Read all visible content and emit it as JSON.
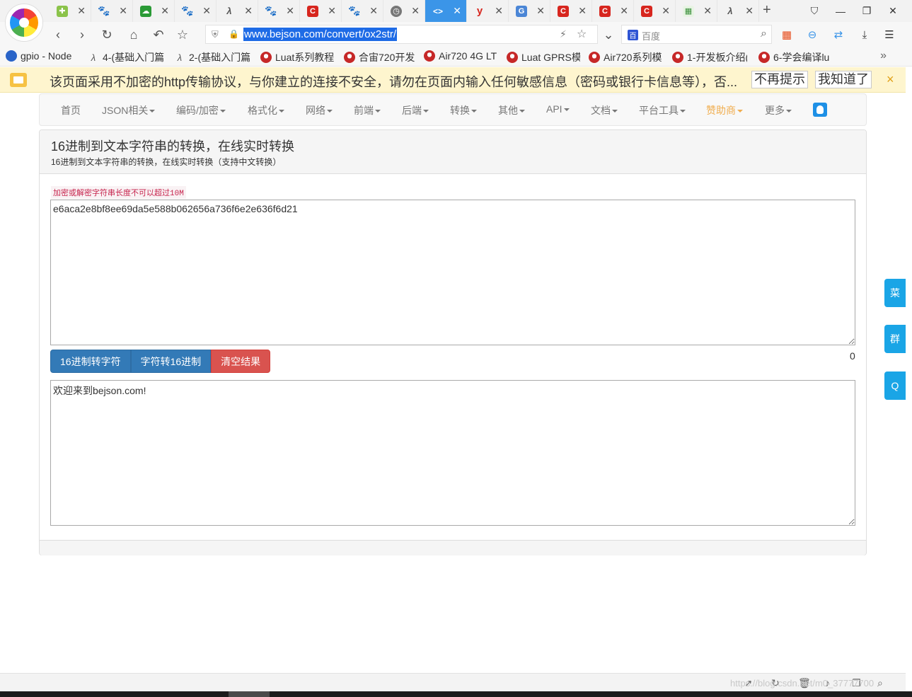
{
  "tabs": [
    {
      "icon": "plus-cross-icon",
      "label": "✚"
    },
    {
      "icon": "baidu-paw-icon",
      "label": "🐾"
    },
    {
      "icon": "green-cloud-icon",
      "label": "☁"
    },
    {
      "icon": "baidu-paw-icon",
      "label": "🐾"
    },
    {
      "icon": "luat-icon",
      "label": "λ"
    },
    {
      "icon": "baidu-paw-icon",
      "label": "🐾"
    },
    {
      "icon": "csdn-icon",
      "label": "C"
    },
    {
      "icon": "baidu-paw-icon",
      "label": "🐾"
    },
    {
      "icon": "clock-icon",
      "label": "◷"
    },
    {
      "icon": "code-icon",
      "label": "<>"
    },
    {
      "icon": "youdao-icon",
      "label": "y"
    },
    {
      "icon": "translate-icon",
      "label": "G"
    },
    {
      "icon": "csdn-icon",
      "label": "C"
    },
    {
      "icon": "csdn-icon",
      "label": "C"
    },
    {
      "icon": "csdn-icon",
      "label": "C"
    },
    {
      "icon": "grid-icon",
      "label": "▦"
    },
    {
      "icon": "luat-icon",
      "label": "λ"
    }
  ],
  "active_tab_index": 9,
  "address": {
    "url": "www.bejson.com/convert/ox2str/"
  },
  "search": {
    "engine_badge": "百",
    "placeholder": "百度"
  },
  "bookmarks": [
    {
      "icon": "blue",
      "label": "gpio - Node"
    },
    {
      "icon": "luat",
      "label": "4-(基础入门篇"
    },
    {
      "icon": "luat",
      "label": "2-(基础入门篇"
    },
    {
      "icon": "cn",
      "label": "Luat系列教程"
    },
    {
      "icon": "cn",
      "label": "合宙720开发"
    },
    {
      "icon": "cn",
      "label": "Air720 4G LT"
    },
    {
      "icon": "cn",
      "label": "Luat GPRS模"
    },
    {
      "icon": "cn",
      "label": "Air720系列模"
    },
    {
      "icon": "cn",
      "label": "1-开发板介绍("
    },
    {
      "icon": "cn",
      "label": "6-学会编译lu"
    }
  ],
  "warning": {
    "text": "该页面采用不加密的http传输协议，与你建立的连接不安全，请勿在页面内输入任何敏感信息（密码或银行卡信息等），否...",
    "btn_no_remind": "不再提示",
    "btn_got_it": "我知道了",
    "close": "×"
  },
  "nav": {
    "items": [
      {
        "label": "首页",
        "caret": false,
        "sponsor": false
      },
      {
        "label": "JSON相关",
        "caret": true,
        "sponsor": false
      },
      {
        "label": "编码/加密",
        "caret": true,
        "sponsor": false
      },
      {
        "label": "格式化",
        "caret": true,
        "sponsor": false
      },
      {
        "label": "网络",
        "caret": true,
        "sponsor": false
      },
      {
        "label": "前端",
        "caret": true,
        "sponsor": false
      },
      {
        "label": "后端",
        "caret": true,
        "sponsor": false
      },
      {
        "label": "转换",
        "caret": true,
        "sponsor": false
      },
      {
        "label": "其他",
        "caret": true,
        "sponsor": false
      },
      {
        "label": "API",
        "caret": true,
        "sponsor": false
      },
      {
        "label": "文档",
        "caret": true,
        "sponsor": false
      },
      {
        "label": "平台工具",
        "caret": true,
        "sponsor": true
      },
      {
        "label": "赞助商",
        "caret": true,
        "sponsor": true
      },
      {
        "label": "更多",
        "caret": true,
        "sponsor": false
      }
    ]
  },
  "panel": {
    "title": "16进制到文本字符串的转换，在线实时转换",
    "subtitle": "16进制到文本字符串的转换，在线实时转换（支持中文转换）",
    "hint": "加密或解密字符串长度不可以超过10M",
    "input_value": "e6aca2e8bf8ee69da5e588b062656a736f6e2e636f6d21",
    "buttons": {
      "hex_to_str": "16进制转字符",
      "str_to_hex": "字符转16进制",
      "clear": "清空结果"
    },
    "count": "0",
    "output_value": "欢迎来到bejson.com!"
  },
  "side_buttons": [
    "菜",
    "群",
    "Q"
  ],
  "statusbar": {
    "watermark": "https://blog.csdn.net/m0_37777700"
  },
  "colors": {
    "accent": "#3b95e8",
    "warning_bg": "#fef5ce",
    "primary_btn": "#337ab7",
    "danger_btn": "#d9534f",
    "sponsor": "#f0ad4e",
    "side_btn": "#1aa5e6"
  }
}
